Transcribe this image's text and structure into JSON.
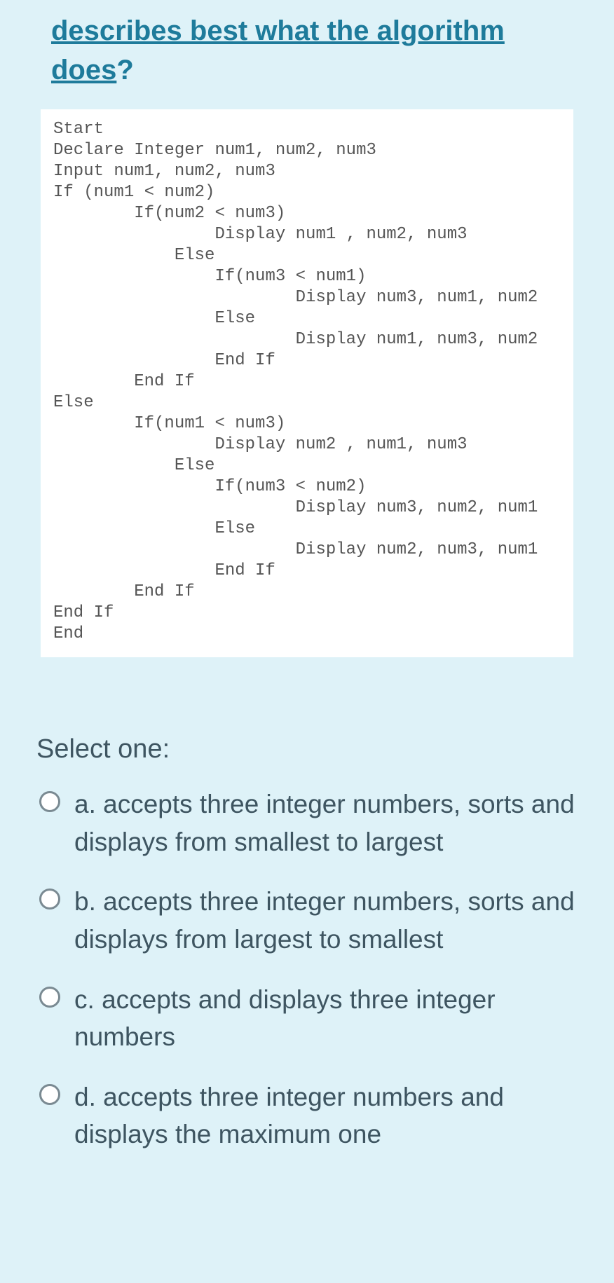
{
  "question": {
    "title_underlined": "describes best what the algorithm does",
    "title_suffix": "?"
  },
  "code": "Start\nDeclare Integer num1, num2, num3\nInput num1, num2, num3\nIf (num1 < num2)\n        If(num2 < num3)\n                Display num1 , num2, num3\n            Else\n                If(num3 < num1)\n                        Display num3, num1, num2\n                Else\n                        Display num1, num3, num2\n                End If\n        End If\nElse\n        If(num1 < num3)\n                Display num2 , num1, num3\n            Else\n                If(num3 < num2)\n                        Display num3, num2, num1\n                Else\n                        Display num2, num3, num1\n                End If\n        End If\nEnd If\nEnd",
  "select_label": "Select one:",
  "options": [
    {
      "letter": "a.",
      "text": "accepts three integer numbers, sorts and displays from smallest to largest"
    },
    {
      "letter": "b.",
      "text": "accepts three integer numbers, sorts and displays from largest to smallest"
    },
    {
      "letter": "c.",
      "text": "accepts and displays three integer numbers"
    },
    {
      "letter": "d.",
      "text": "accepts three integer numbers and displays the maximum one"
    }
  ]
}
